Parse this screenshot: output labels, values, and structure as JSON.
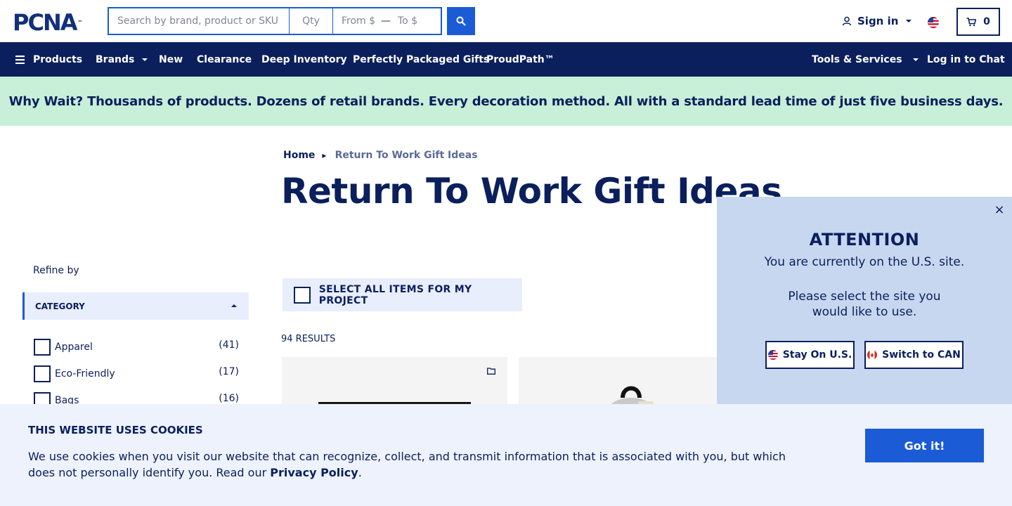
{
  "header": {
    "logo_text": "PCNA",
    "logo_tm": "™",
    "search_placeholder": "Search by brand, product or SKU",
    "qty_placeholder": "Qty",
    "price_from_placeholder": "From $",
    "price_to_placeholder": "To $",
    "sign_in_label": "Sign in",
    "cart_count": "0"
  },
  "nav": {
    "items": [
      {
        "label": "Products"
      },
      {
        "label": "Brands"
      },
      {
        "label": "New"
      },
      {
        "label": "Clearance"
      },
      {
        "label": "Deep Inventory"
      },
      {
        "label": "Perfectly Packaged Gifts"
      },
      {
        "label": "ProudPath™"
      },
      {
        "label": "Tools & Services"
      },
      {
        "label": "Log in to Chat"
      }
    ]
  },
  "banner": {
    "text": "Why Wait? Thousands of products. Dozens of retail brands. Every decoration method. All with a standard lead time of just five business days."
  },
  "breadcrumb": {
    "home": "Home",
    "current": "Return To Work Gift Ideas"
  },
  "page_title": "Return To Work Gift Ideas",
  "sidebar": {
    "refine_label": "Refine by",
    "category_header": "CATEGORY",
    "categories": [
      {
        "label": "Apparel",
        "count": "(41)"
      },
      {
        "label": "Eco-Friendly",
        "count": "(17)"
      },
      {
        "label": "Bags",
        "count": "(16)"
      }
    ]
  },
  "main": {
    "select_all_label": "SELECT ALL ITEMS FOR MY PROJECT",
    "results_label": "94 RESULTS"
  },
  "popup": {
    "close_symbol": "×",
    "title": "ATTENTION",
    "line1": "You are currently on the U.S. site.",
    "line2": "Please select the site you",
    "line3": "would like to use.",
    "stay_label": "Stay On U.S.",
    "switch_label": "Switch to CAN"
  },
  "cookie": {
    "title": "THIS WEBSITE USES COOKIES",
    "text_before": "We use cookies when you visit our website that can recognize, collect, and transmit information that is associated with you, but which does not personally identify you. Read our ",
    "policy_link": "Privacy Policy",
    "text_after": ".",
    "button_label": "Got it!"
  },
  "colors": {
    "brand_navy": "#0b1f5c",
    "accent_blue": "#1b5bd6",
    "banner_green": "#c8efd8",
    "popup_bg": "#c7d7f0",
    "cookie_bg": "#edf2fc"
  }
}
